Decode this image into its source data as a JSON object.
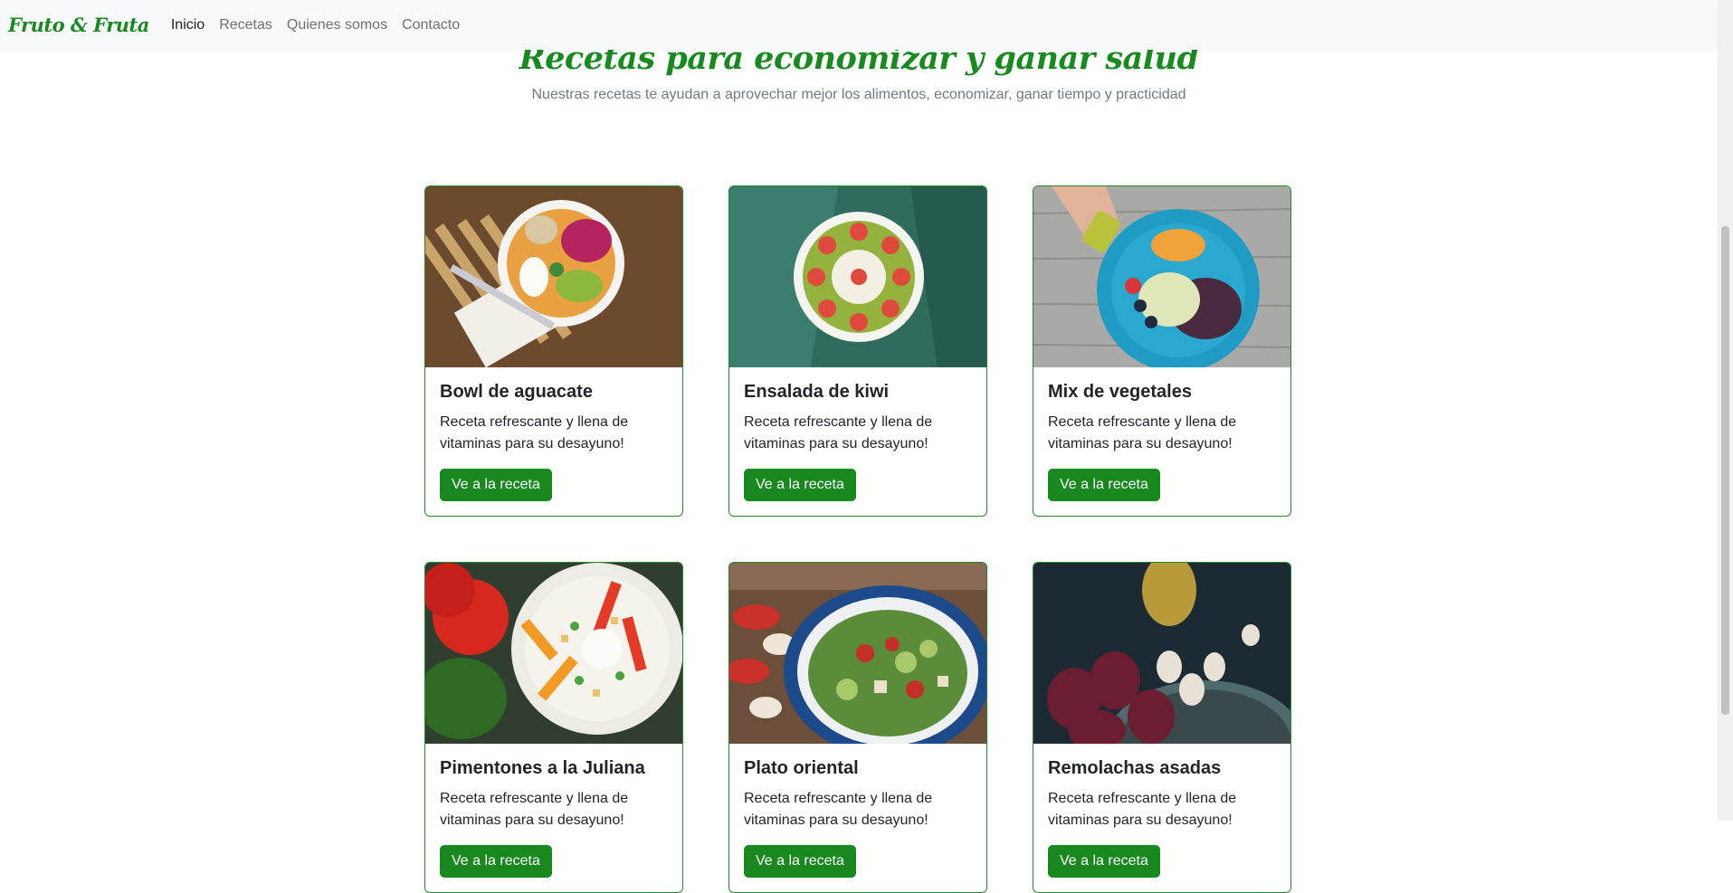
{
  "navbar": {
    "brand": "Fruto & Fruta",
    "links": [
      "Inicio",
      "Recetas",
      "Quienes somos",
      "Contacto"
    ]
  },
  "hero": {
    "title": "Recetas para economizar y ganar salud",
    "subtitle": "Nuestras recetas te ayudan a aprovechar mejor los alimentos, economizar, ganar tiempo y practicidad"
  },
  "cards": [
    {
      "title": "Bowl de aguacate",
      "text": "Receta refrescante y llena de vitaminas para su desayuno!",
      "button": "Ve a la receta"
    },
    {
      "title": "Ensalada de kiwi",
      "text": "Receta refrescante y llena de vitaminas para su desayuno!",
      "button": "Ve a la receta"
    },
    {
      "title": "Mix de vegetales",
      "text": "Receta refrescante y llena de vitaminas para su desayuno!",
      "button": "Ve a la receta"
    },
    {
      "title": "Pimentones a la Juliana",
      "text": "Receta refrescante y llena de vitaminas para su desayuno!",
      "button": "Ve a la receta"
    },
    {
      "title": "Plato oriental",
      "text": "Receta refrescante y llena de vitaminas para su desayuno!",
      "button": "Ve a la receta"
    },
    {
      "title": "Remolachas asadas",
      "text": "Receta refrescante y llena de vitaminas para su desayuno!",
      "button": "Ve a la receta"
    }
  ],
  "colors": {
    "brand": "#198a1f",
    "button": "#18881f",
    "card_border": "#1f8a27"
  }
}
